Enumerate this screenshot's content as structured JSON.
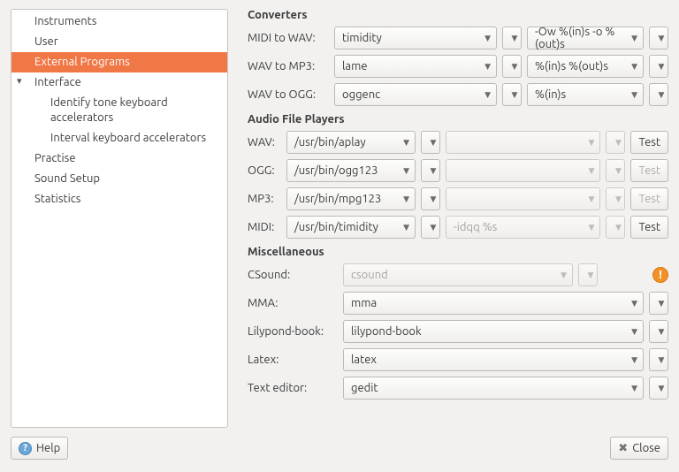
{
  "sidebar": {
    "items": [
      {
        "label": "Instruments",
        "selected": false,
        "child": false,
        "expand": ""
      },
      {
        "label": "User",
        "selected": false,
        "child": false,
        "expand": ""
      },
      {
        "label": "External Programs",
        "selected": true,
        "child": false,
        "expand": ""
      },
      {
        "label": "Interface",
        "selected": false,
        "child": false,
        "expand": "down"
      },
      {
        "label": "Identify tone keyboard accelerators",
        "selected": false,
        "child": true,
        "expand": ""
      },
      {
        "label": "Interval keyboard accelerators",
        "selected": false,
        "child": true,
        "expand": ""
      },
      {
        "label": "Practise",
        "selected": false,
        "child": false,
        "expand": ""
      },
      {
        "label": "Sound Setup",
        "selected": false,
        "child": false,
        "expand": ""
      },
      {
        "label": "Statistics",
        "selected": false,
        "child": false,
        "expand": ""
      }
    ]
  },
  "sections": {
    "converters_title": "Converters",
    "audio_title": "Audio File Players",
    "misc_title": "Miscellaneous"
  },
  "converters": [
    {
      "label": "MIDI to WAV:",
      "cmd": "timidity",
      "args": "-Ow %(in)s -o %(out)s"
    },
    {
      "label": "WAV to MP3:",
      "cmd": "lame",
      "args": "%(in)s %(out)s"
    },
    {
      "label": "WAV to OGG:",
      "cmd": "oggenc",
      "args": "%(in)s"
    }
  ],
  "audio_players": [
    {
      "label": "WAV:",
      "cmd": "/usr/bin/aplay",
      "args": "",
      "test": "Test",
      "test_enabled": true,
      "args_enabled": false
    },
    {
      "label": "OGG:",
      "cmd": "/usr/bin/ogg123",
      "args": "",
      "test": "Test",
      "test_enabled": false,
      "args_enabled": false
    },
    {
      "label": "MP3:",
      "cmd": "/usr/bin/mpg123",
      "args": "",
      "test": "Test",
      "test_enabled": false,
      "args_enabled": false
    },
    {
      "label": "MIDI:",
      "cmd": "/usr/bin/timidity",
      "args": "-idqq %s",
      "test": "Test",
      "test_enabled": true,
      "args_enabled": false
    }
  ],
  "misc": [
    {
      "label": "CSound:",
      "value": "csound",
      "enabled": false,
      "warn": true
    },
    {
      "label": "MMA:",
      "value": "mma",
      "enabled": true,
      "warn": false
    },
    {
      "label": "Lilypond-book:",
      "value": "lilypond-book",
      "enabled": true,
      "warn": false
    },
    {
      "label": "Latex:",
      "value": "latex",
      "enabled": true,
      "warn": false
    },
    {
      "label": "Text editor:",
      "value": "gedit",
      "enabled": true,
      "warn": false
    }
  ],
  "footer": {
    "help": "Help",
    "close": "Close"
  }
}
